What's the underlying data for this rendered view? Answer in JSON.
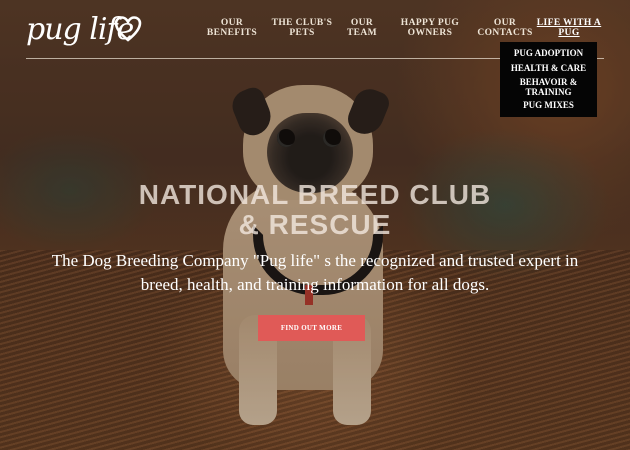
{
  "logo": {
    "text": "pug life",
    "icon": "heart-icon"
  },
  "nav": {
    "items": [
      {
        "label": "OUR\nBENEFITS",
        "active": false
      },
      {
        "label": "THE CLUB'S\nPETS",
        "active": false
      },
      {
        "label": "OUR\nTEAM",
        "active": false
      },
      {
        "label": "HAPPY PUG\nOWNERS",
        "active": false
      },
      {
        "label": "OUR\nCONTACTS",
        "active": false
      },
      {
        "label": "LIFE WITH A\nPUG",
        "active": true
      }
    ],
    "dropdown": [
      "PUG ADOPTION",
      "HEALTH & CARE",
      "BEHAVOIR &\nTRAINING",
      "PUG MIXES"
    ]
  },
  "hero": {
    "headline": "NATIONAL BREED CLUB\n& RESCUE",
    "subtext": "The Dog Breeding Company \"Pug life\" s the recognized and trusted expert in breed, health, and training information for all dogs.",
    "cta": "FIND OUT MORE"
  },
  "colors": {
    "cta_bg": "#e05a57",
    "dropdown_bg": "#050505",
    "nav_text": "#eee4d6"
  }
}
